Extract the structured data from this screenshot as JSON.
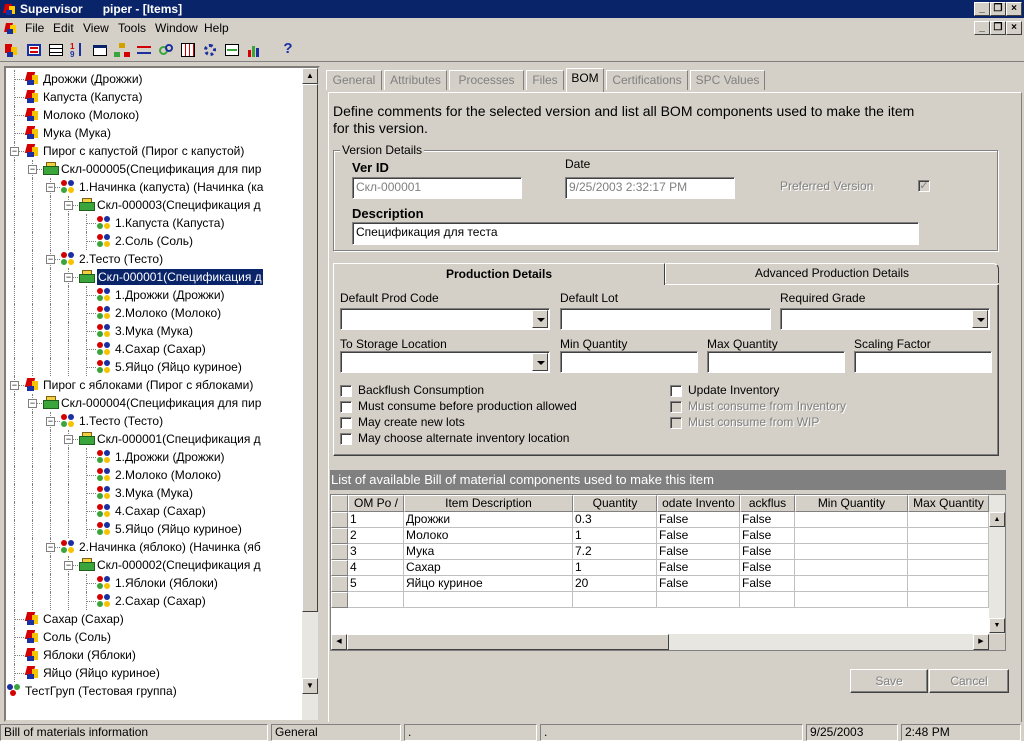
{
  "window": {
    "app_name": "Supervisor",
    "title": "piper - [Items]"
  },
  "menu": [
    "File",
    "Edit",
    "View",
    "Tools",
    "Window",
    "Help"
  ],
  "toolbar_icons": [
    "items-icon",
    "bom-icon",
    "table-icon",
    "sort-icon",
    "properties-icon",
    "hierarchy-icon",
    "transfer-icon",
    "link-icon",
    "grid-icon",
    "gear-icon",
    "report-icon",
    "chart-icon",
    "help-icon"
  ],
  "tree": [
    {
      "label": "Дрожжи (Дрожжи)",
      "icon": "item",
      "depth": 2
    },
    {
      "label": "Капуста (Капуста)",
      "icon": "item",
      "depth": 2
    },
    {
      "label": "Молоко (Молоко)",
      "icon": "item",
      "depth": 2
    },
    {
      "label": "Мука (Мука)",
      "icon": "item",
      "depth": 2
    },
    {
      "label": "Пирог с капустой (Пирог с капустой)",
      "icon": "item",
      "depth": 2,
      "expander": "-"
    },
    {
      "label": "Скл-000005(Спецификация для пир",
      "icon": "bom",
      "depth": 3,
      "expander": "-"
    },
    {
      "label": "1.Начинка (капуста) (Начинка (ка",
      "icon": "comp",
      "depth": 4,
      "expander": "-"
    },
    {
      "label": "Скл-000003(Спецификация д",
      "icon": "bom",
      "depth": 5,
      "expander": "-"
    },
    {
      "label": "1.Капуста (Капуста)",
      "icon": "comp",
      "depth": 6
    },
    {
      "label": "2.Соль (Соль)",
      "icon": "comp",
      "depth": 6
    },
    {
      "label": "2.Тесто (Тесто)",
      "icon": "comp",
      "depth": 4,
      "expander": "-"
    },
    {
      "label": "Скл-000001(Спецификация д",
      "icon": "bom",
      "depth": 5,
      "expander": "-",
      "selected": true
    },
    {
      "label": "1.Дрожжи (Дрожжи)",
      "icon": "comp",
      "depth": 6
    },
    {
      "label": "2.Молоко (Молоко)",
      "icon": "comp",
      "depth": 6
    },
    {
      "label": "3.Мука (Мука)",
      "icon": "comp",
      "depth": 6
    },
    {
      "label": "4.Сахар (Сахар)",
      "icon": "comp",
      "depth": 6
    },
    {
      "label": "5.Яйцо (Яйцо куриное)",
      "icon": "comp",
      "depth": 6
    },
    {
      "label": "Пирог с яблоками (Пирог с яблоками)",
      "icon": "item",
      "depth": 2,
      "expander": "-"
    },
    {
      "label": "Скл-000004(Спецификация для пир",
      "icon": "bom",
      "depth": 3,
      "expander": "-"
    },
    {
      "label": "1.Тесто (Тесто)",
      "icon": "comp",
      "depth": 4,
      "expander": "-"
    },
    {
      "label": "Скл-000001(Спецификация д",
      "icon": "bom",
      "depth": 5,
      "expander": "-"
    },
    {
      "label": "1.Дрожжи (Дрожжи)",
      "icon": "comp",
      "depth": 6
    },
    {
      "label": "2.Молоко (Молоко)",
      "icon": "comp",
      "depth": 6
    },
    {
      "label": "3.Мука (Мука)",
      "icon": "comp",
      "depth": 6
    },
    {
      "label": "4.Сахар (Сахар)",
      "icon": "comp",
      "depth": 6
    },
    {
      "label": "5.Яйцо (Яйцо куриное)",
      "icon": "comp",
      "depth": 6
    },
    {
      "label": "2.Начинка (яблоко) (Начинка (яб",
      "icon": "comp",
      "depth": 4,
      "expander": "-"
    },
    {
      "label": "Скл-000002(Спецификация д",
      "icon": "bom",
      "depth": 5,
      "expander": "-"
    },
    {
      "label": "1.Яблоки (Яблоки)",
      "icon": "comp",
      "depth": 6
    },
    {
      "label": "2.Сахар (Сахар)",
      "icon": "comp",
      "depth": 6
    },
    {
      "label": "Сахар (Сахар)",
      "icon": "item",
      "depth": 2
    },
    {
      "label": "Соль (Соль)",
      "icon": "item",
      "depth": 2
    },
    {
      "label": "Яблоки (Яблоки)",
      "icon": "item",
      "depth": 2
    },
    {
      "label": "Яйцо (Яйцо куриное)",
      "icon": "item",
      "depth": 2
    },
    {
      "label": "ТестГруп (Тестовая группа)",
      "icon": "group",
      "depth": 1,
      "expander": "+"
    }
  ],
  "tabs": [
    {
      "label": "General",
      "active": false
    },
    {
      "label": "Attributes",
      "active": false
    },
    {
      "label": "Processes",
      "active": false
    },
    {
      "label": "Files",
      "active": false
    },
    {
      "label": "BOM",
      "active": true
    },
    {
      "label": "Certifications",
      "active": false
    },
    {
      "label": "SPC Values",
      "active": false
    }
  ],
  "bom": {
    "intro": "Define comments for the selected version and list all BOM components used to make the item for this version.",
    "intro_line1": "Define comments for the selected version and list all BOM components used to make the item",
    "intro_line2": "for this version.",
    "version_group": "Version Details",
    "ver_id_label": "Ver ID",
    "ver_id_value": "Скл-000001",
    "date_label": "Date",
    "date_value": "9/25/2003 2:32:17 PM",
    "preferred_label": "Preferred Version",
    "preferred_checked": true,
    "description_label": "Description",
    "description_value": "Спецификация для теста",
    "subtabs": [
      "Production Details",
      "Advanced Production Details"
    ],
    "default_prod_code_label": "Default Prod Code",
    "default_lot_label": "Default Lot",
    "required_grade_label": "Required Grade",
    "to_storage_label": "To Storage Location",
    "min_qty_label": "Min Quantity",
    "max_qty_label": "Max Quantity",
    "scaling_factor_label": "Scaling Factor",
    "checkboxes_left": [
      {
        "label": "Backflush Consumption",
        "checked": false,
        "disabled": false
      },
      {
        "label": "Must consume before production allowed",
        "checked": false,
        "disabled": false
      },
      {
        "label": "May create new lots",
        "checked": false,
        "disabled": false
      },
      {
        "label": "May choose alternate inventory location",
        "checked": false,
        "disabled": false
      }
    ],
    "checkboxes_right": [
      {
        "label": "Update Inventory",
        "checked": false,
        "disabled": false
      },
      {
        "label": "Must consume from Inventory",
        "checked": false,
        "disabled": true
      },
      {
        "label": "Must consume from WIP",
        "checked": false,
        "disabled": true
      }
    ],
    "list_caption": "List of available Bill of material components used to make this item",
    "columns": [
      "BOM Po /",
      "Item Description",
      "Quantity",
      "Update Inventory",
      "Backflush",
      "Min Quantity",
      "Max Quantity"
    ],
    "columns_visible": [
      "OM Po /",
      "Item Description",
      "Quantity",
      "odate Invento",
      "ackflus",
      "Min Quantity",
      "Max Quantity"
    ],
    "rows": [
      {
        "pos": "1",
        "desc": "Дрожжи",
        "qty": "0.3",
        "update": "False",
        "backflush": "False",
        "min": "",
        "max": ""
      },
      {
        "pos": "2",
        "desc": "Молоко",
        "qty": "1",
        "update": "False",
        "backflush": "False",
        "min": "",
        "max": ""
      },
      {
        "pos": "3",
        "desc": "Мука",
        "qty": "7.2",
        "update": "False",
        "backflush": "False",
        "min": "",
        "max": ""
      },
      {
        "pos": "4",
        "desc": "Сахар",
        "qty": "1",
        "update": "False",
        "backflush": "False",
        "min": "",
        "max": ""
      },
      {
        "pos": "5",
        "desc": "Яйцо куриное",
        "qty": "20",
        "update": "False",
        "backflush": "False",
        "min": "",
        "max": ""
      }
    ],
    "save_label": "Save",
    "cancel_label": "Cancel"
  },
  "status": {
    "message": "Bill of materials information",
    "mode": "General",
    "p1": ".",
    "p2": ".",
    "date": "9/25/2003",
    "time": "2:48 PM"
  }
}
